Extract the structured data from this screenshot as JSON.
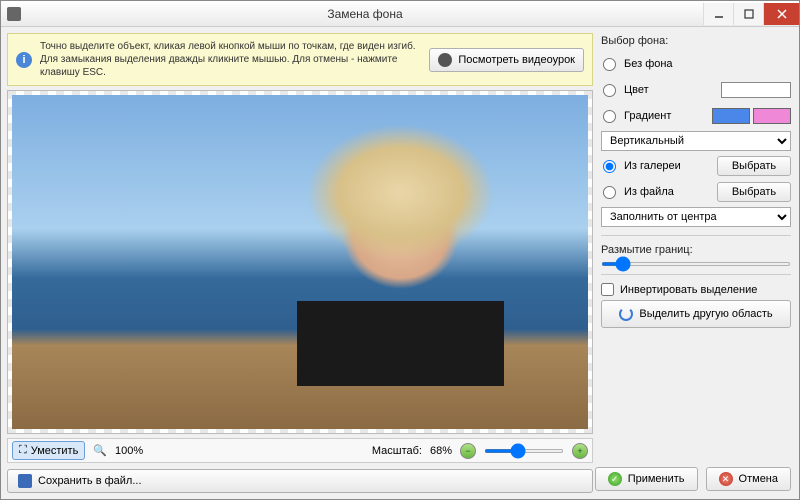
{
  "window": {
    "title": "Замена фона"
  },
  "hint": {
    "text": "Точно выделите объект, кликая левой кнопкой мыши по точкам, где виден изгиб. Для замыкания выделения дважды кликните мышью. Для отмены - нажмите клавишу ESC.",
    "video_btn": "Посмотреть видеоурок"
  },
  "toolbar": {
    "fit_label": "Уместить",
    "zoom_text": "100%",
    "scale_label": "Масштаб:",
    "scale_value": "68%"
  },
  "save_btn": "Сохранить в файл...",
  "sidebar": {
    "group_label": "Выбор фона:",
    "radios": {
      "none": "Без фона",
      "color": "Цвет",
      "gradient": "Градиент",
      "gallery": "Из галереи",
      "file": "Из файла"
    },
    "gradient_type": "Вертикальный",
    "choose_btn": "Выбрать",
    "fill_mode": "Заполнить от центра",
    "blur_label": "Размытие границ:",
    "invert_label": "Инвертировать выделение",
    "select_other": "Выделить другую область",
    "colors": {
      "grad1": "#4a87e8",
      "grad2": "#f088d8",
      "solid": "#ffffff"
    }
  },
  "footer": {
    "apply": "Применить",
    "cancel": "Отмена"
  }
}
